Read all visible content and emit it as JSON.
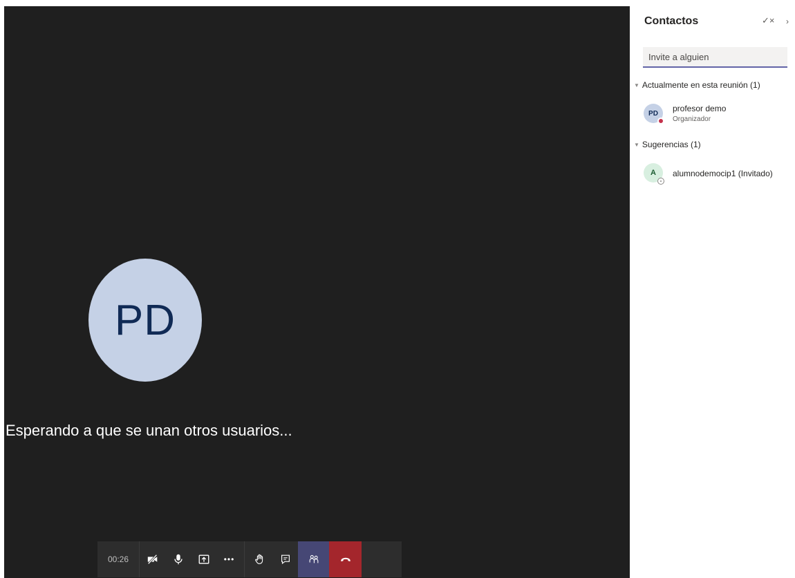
{
  "stage": {
    "avatar_initials": "PD",
    "waiting_message": "Esperando a que se unan otros usuarios..."
  },
  "toolbar": {
    "timer": "00:26",
    "buttons": [
      {
        "icon": "camera-off-icon"
      },
      {
        "icon": "microphone-icon"
      },
      {
        "icon": "share-screen-icon"
      },
      {
        "icon": "more-options-icon",
        "glyph": "•••"
      },
      {
        "icon": "raise-hand-icon"
      },
      {
        "icon": "chat-icon"
      },
      {
        "icon": "participants-icon"
      },
      {
        "icon": "hang-up-icon"
      }
    ],
    "colors": {
      "bar": "#2d2d2d",
      "active": "#464775",
      "hangup": "#a4262c"
    }
  },
  "panel": {
    "title": "Contactos",
    "check_icon": "✓×",
    "close_icon": "›",
    "invite_placeholder": "Invite a alguien",
    "sections": [
      {
        "label": "Actualmente en esta reunión (1)",
        "people": [
          {
            "initials": "PD",
            "name": "profesor demo",
            "role": "Organizador",
            "status": "busy"
          }
        ]
      },
      {
        "label": "Sugerencias (1)",
        "people": [
          {
            "initials": "A",
            "name": "alumnodemocip1 (Invitado)",
            "status": "away"
          }
        ]
      }
    ],
    "colors": {
      "accent": "#6264a7",
      "busy": "#c4314b"
    }
  }
}
